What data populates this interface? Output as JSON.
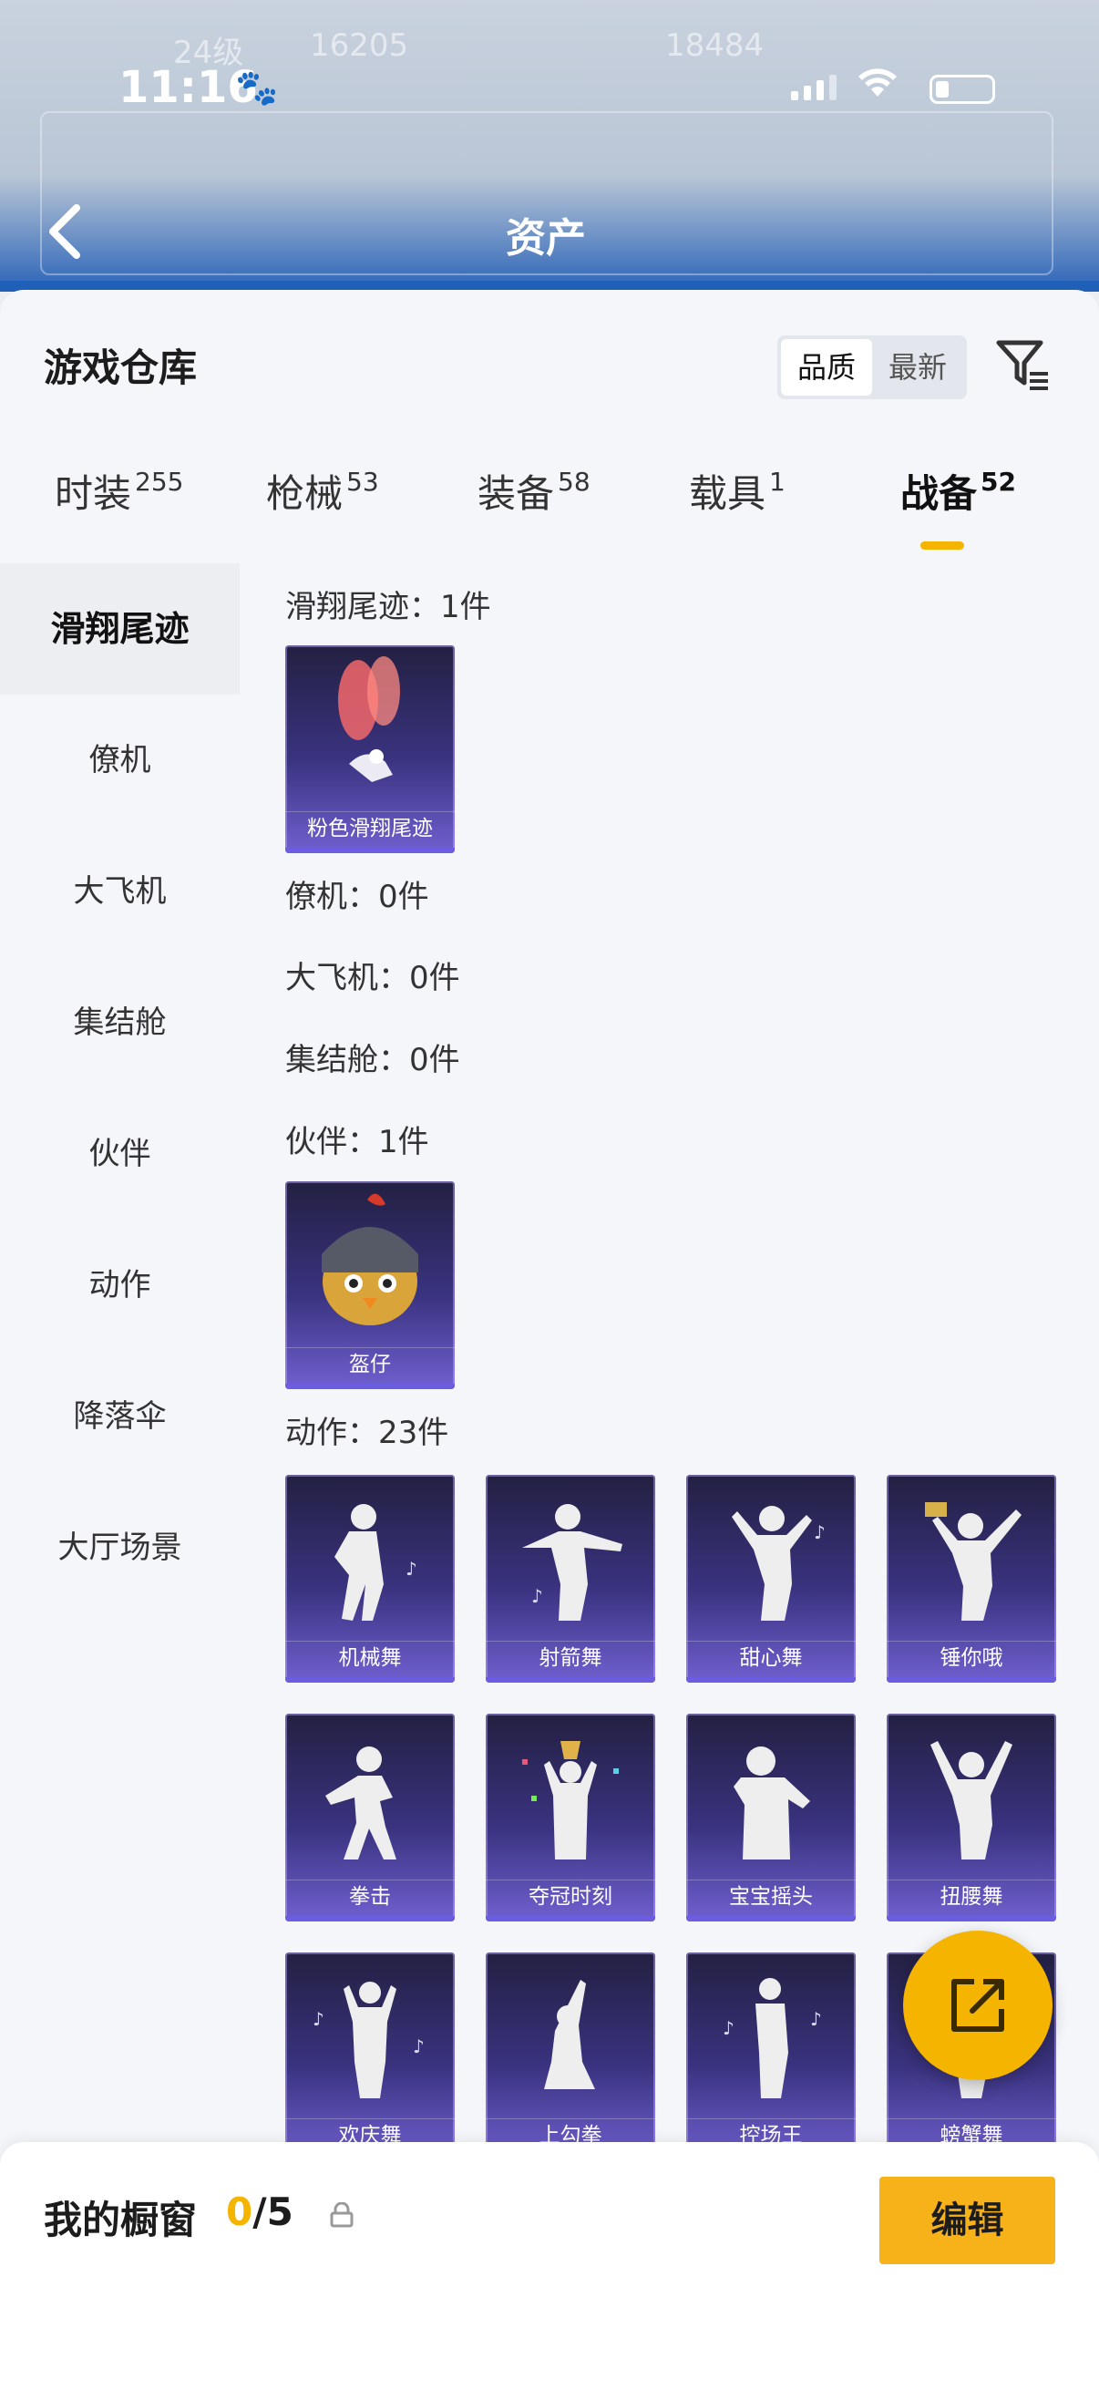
{
  "status_bar": {
    "time": "11:16"
  },
  "background_header": {
    "title": "资产",
    "ghost_texts": [
      "24级",
      "16205",
      "18484"
    ]
  },
  "warehouse": {
    "title": "游戏仓库",
    "sort_options": [
      "品质",
      "最新"
    ],
    "sort_selected": "品质",
    "tabs": [
      {
        "label": "时装",
        "count": "255"
      },
      {
        "label": "枪械",
        "count": "53"
      },
      {
        "label": "装备",
        "count": "58"
      },
      {
        "label": "载具",
        "count": "1"
      },
      {
        "label": "战备",
        "count": "52"
      }
    ],
    "active_tab": "战备"
  },
  "categories": [
    "滑翔尾迹",
    "僚机",
    "大飞机",
    "集结舱",
    "伙伴",
    "动作",
    "降落伞",
    "大厅场景"
  ],
  "active_category": "滑翔尾迹",
  "sections": {
    "glide": {
      "title": "滑翔尾迹：1件",
      "items": [
        "粉色滑翔尾迹"
      ]
    },
    "wingman": {
      "title": "僚机：0件"
    },
    "plane": {
      "title": "大飞机：0件"
    },
    "pod": {
      "title": "集结舱：0件"
    },
    "companion": {
      "title": "伙伴：1件",
      "items": [
        "盔仔"
      ]
    },
    "emote": {
      "title": "动作：23件",
      "items": [
        "机械舞",
        "射箭舞",
        "甜心舞",
        "锤你哦",
        "拳击",
        "夺冠时刻",
        "宝宝摇头",
        "扭腰舞",
        "欢庆舞",
        "上勾拳",
        "控场王",
        "螃蟹舞"
      ]
    }
  },
  "showcase": {
    "label": "我的橱窗",
    "current": "0",
    "total": "/5",
    "edit_label": "编辑"
  },
  "colors": {
    "accent": "#f5b400",
    "card_top": "#232042",
    "card_bottom": "#7060d0"
  }
}
